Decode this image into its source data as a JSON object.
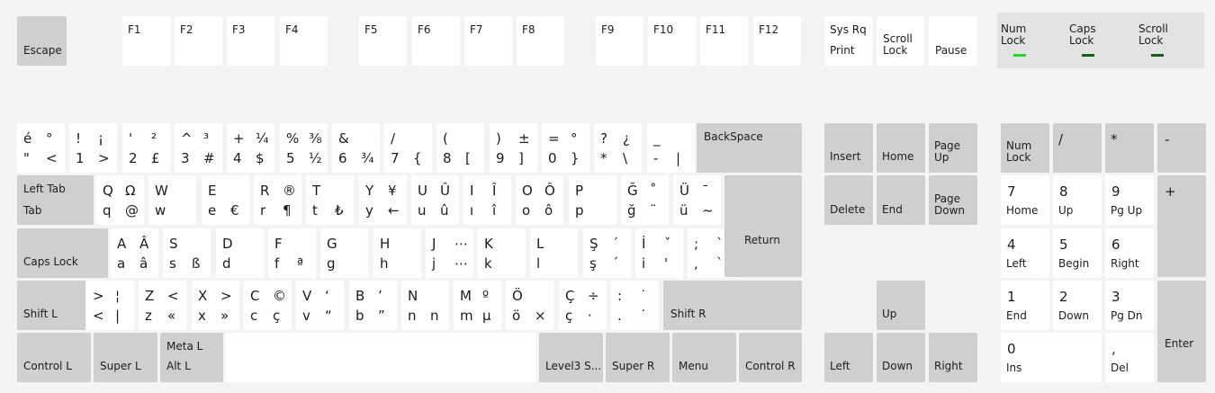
{
  "function_row": [
    {
      "id": "escape",
      "label": "Escape",
      "mod": true
    },
    {
      "id": "f1",
      "label": "F1"
    },
    {
      "id": "f2",
      "label": "F2"
    },
    {
      "id": "f3",
      "label": "F3"
    },
    {
      "id": "f4",
      "label": "F4"
    },
    {
      "id": "f5",
      "label": "F5"
    },
    {
      "id": "f6",
      "label": "F6"
    },
    {
      "id": "f7",
      "label": "F7"
    },
    {
      "id": "f8",
      "label": "F8"
    },
    {
      "id": "f9",
      "label": "F9"
    },
    {
      "id": "f10",
      "label": "F10"
    },
    {
      "id": "f11",
      "label": "F11"
    },
    {
      "id": "f12",
      "label": "F12"
    },
    {
      "id": "sysrq",
      "top": "Sys Rq",
      "bottom": "Print"
    },
    {
      "id": "scroll-lock",
      "label": "Scroll\nLock"
    },
    {
      "id": "pause",
      "label": "Pause"
    }
  ],
  "indicators": {
    "num_lock": {
      "label": "Num\nLock",
      "color": "#28d428"
    },
    "caps_lock": {
      "label": "Caps\nLock",
      "color": "#175c17"
    },
    "scroll_lock": {
      "label": "Scroll\nLock",
      "color": "#175c17"
    }
  },
  "rows": {
    "number": [
      {
        "tl": "é",
        "tr": "°",
        "bl": "\"",
        "br": "<"
      },
      {
        "tl": "!",
        "tr": "¡",
        "bl": "1",
        "br": ">"
      },
      {
        "tl": "'",
        "tr": "²",
        "bl": "2",
        "br": "£"
      },
      {
        "tl": "^",
        "tr": "³",
        "bl": "3",
        "br": "#"
      },
      {
        "tl": "+",
        "tr": "¼",
        "bl": "4",
        "br": "$"
      },
      {
        "tl": "%",
        "tr": "⅜",
        "bl": "5",
        "br": "½"
      },
      {
        "tl": "&",
        "tr": "",
        "bl": "6",
        "br": "¾"
      },
      {
        "tl": "/",
        "tr": "",
        "bl": "7",
        "br": "{"
      },
      {
        "tl": "(",
        "tr": "",
        "bl": "8",
        "br": "["
      },
      {
        "tl": ")",
        "tr": "±",
        "bl": "9",
        "br": "]"
      },
      {
        "tl": "=",
        "tr": "°",
        "bl": "0",
        "br": "}"
      },
      {
        "tl": "?",
        "tr": "¿",
        "bl": "*",
        "br": "\\"
      },
      {
        "tl": "_",
        "tr": "",
        "bl": "-",
        "br": "|"
      }
    ],
    "top": [
      {
        "tl": "Q",
        "tr": "Ω",
        "bl": "q",
        "br": "@"
      },
      {
        "tl": "W",
        "tr": "",
        "bl": "w",
        "br": ""
      },
      {
        "tl": "E",
        "tr": "",
        "bl": "e",
        "br": "€"
      },
      {
        "tl": "R",
        "tr": "®",
        "bl": "r",
        "br": "¶"
      },
      {
        "tl": "T",
        "tr": "",
        "bl": "t",
        "br": "₺"
      },
      {
        "tl": "Y",
        "tr": "¥",
        "bl": "y",
        "br": "←"
      },
      {
        "tl": "U",
        "tr": "Û",
        "bl": "u",
        "br": "û"
      },
      {
        "tl": "I",
        "tr": "Î",
        "bl": "ı",
        "br": "î"
      },
      {
        "tl": "O",
        "tr": "Ô",
        "bl": "o",
        "br": "ô"
      },
      {
        "tl": "P",
        "tr": "",
        "bl": "p",
        "br": ""
      },
      {
        "tl": "Ğ",
        "tr": "˚",
        "bl": "ğ",
        "br": "¨"
      },
      {
        "tl": "Ü",
        "tr": "¯",
        "bl": "ü",
        "br": "~"
      }
    ],
    "home": [
      {
        "tl": "A",
        "tr": "Â",
        "bl": "a",
        "br": "â"
      },
      {
        "tl": "S",
        "tr": "",
        "bl": "s",
        "br": "ß"
      },
      {
        "tl": "D",
        "tr": "",
        "bl": "d",
        "br": ""
      },
      {
        "tl": "F",
        "tr": "",
        "bl": "f",
        "br": "ª"
      },
      {
        "tl": "G",
        "tr": "",
        "bl": "g",
        "br": ""
      },
      {
        "tl": "H",
        "tr": "",
        "bl": "h",
        "br": ""
      },
      {
        "tl": "J",
        "tr": "⋯",
        "bl": "j",
        "br": "⋯"
      },
      {
        "tl": "K",
        "tr": "",
        "bl": "k",
        "br": ""
      },
      {
        "tl": "L",
        "tr": "",
        "bl": "l",
        "br": ""
      },
      {
        "tl": "Ş",
        "tr": "´",
        "bl": "ş",
        "br": "´"
      },
      {
        "tl": "İ",
        "tr": "ˇ",
        "bl": "i",
        "br": "'"
      },
      {
        "tl": ";",
        "tr": "`",
        "bl": ",",
        "br": "`"
      }
    ],
    "bottom": [
      {
        "tl": ">",
        "tr": "¦",
        "bl": "<",
        "br": "|"
      },
      {
        "tl": "Z",
        "tr": "<",
        "bl": "z",
        "br": "«"
      },
      {
        "tl": "X",
        "tr": ">",
        "bl": "x",
        "br": "»"
      },
      {
        "tl": "C",
        "tr": "©",
        "bl": "c",
        "br": "ç"
      },
      {
        "tl": "V",
        "tr": "‘",
        "bl": "v",
        "br": "“"
      },
      {
        "tl": "B",
        "tr": "’",
        "bl": "b",
        "br": "”"
      },
      {
        "tl": "N",
        "tr": "",
        "bl": "n",
        "br": "n"
      },
      {
        "tl": "M",
        "tr": "º",
        "bl": "m",
        "br": "µ"
      },
      {
        "tl": "Ö",
        "tr": "",
        "bl": "ö",
        "br": "×"
      },
      {
        "tl": "Ç",
        "tr": "÷",
        "bl": "ç",
        "br": "·"
      },
      {
        "tl": ":",
        "tr": "˙",
        "bl": ".",
        "br": "˙"
      }
    ]
  },
  "mods": {
    "backspace": "BackSpace",
    "tab_top": "Left Tab",
    "tab_bottom": "Tab",
    "caps": "Caps Lock",
    "return": "Return",
    "shift_l": "Shift L",
    "shift_r": "Shift R",
    "control_l": "Control L",
    "super_l": "Super L",
    "meta_l": "Meta L",
    "alt_l": "Alt L",
    "level3": "Level3 S...",
    "super_r": "Super R",
    "menu": "Menu",
    "control_r": "Control R"
  },
  "nav": {
    "insert": "Insert",
    "home": "Home",
    "page_up": "Page\nUp",
    "delete": "Delete",
    "end": "End",
    "page_down": "Page\nDown",
    "up": "Up",
    "left": "Left",
    "down": "Down",
    "right": "Right"
  },
  "numpad": {
    "num_lock": "Num\nLock",
    "divide": "/",
    "multiply": "*",
    "minus": "-",
    "plus": "+",
    "enter": "Enter",
    "keys": [
      {
        "id": "kp7",
        "top": "7",
        "bottom": "Home"
      },
      {
        "id": "kp8",
        "top": "8",
        "bottom": "Up"
      },
      {
        "id": "kp9",
        "top": "9",
        "bottom": "Pg Up"
      },
      {
        "id": "kp4",
        "top": "4",
        "bottom": "Left"
      },
      {
        "id": "kp5",
        "top": "5",
        "bottom": "Begin"
      },
      {
        "id": "kp6",
        "top": "6",
        "bottom": "Right"
      },
      {
        "id": "kp1",
        "top": "1",
        "bottom": "End"
      },
      {
        "id": "kp2",
        "top": "2",
        "bottom": "Down"
      },
      {
        "id": "kp3",
        "top": "3",
        "bottom": "Pg Dn"
      },
      {
        "id": "kp0",
        "top": "0",
        "bottom": "Ins"
      },
      {
        "id": "kpdot",
        "top": ",",
        "bottom": "Del"
      }
    ]
  }
}
